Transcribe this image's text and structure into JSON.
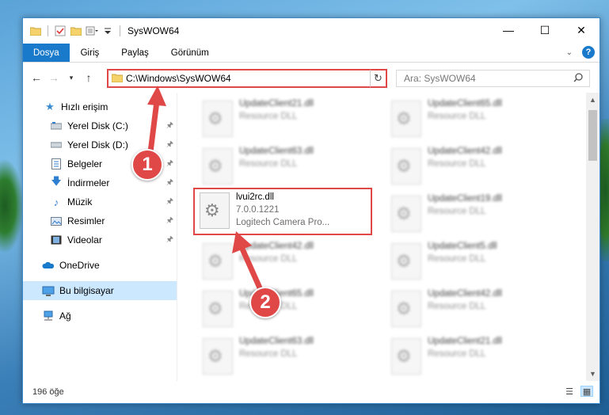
{
  "window": {
    "title": "SysWOW64",
    "controls": {
      "minimize": "—",
      "maximize": "☐",
      "close": "✕"
    }
  },
  "ribbon": {
    "tabs": [
      "Dosya",
      "Giriş",
      "Paylaş",
      "Görünüm"
    ]
  },
  "address": {
    "path": "C:\\Windows\\SysWOW64",
    "search_placeholder": "Ara: SysWOW64"
  },
  "nav": {
    "quick_access": "Hızlı erişim",
    "items": [
      {
        "label": "Yerel Disk (C:)",
        "icon": "drive-icon",
        "pinned": true
      },
      {
        "label": "Yerel Disk (D:)",
        "icon": "drive-icon",
        "pinned": true
      },
      {
        "label": "Belgeler",
        "icon": "documents-icon",
        "pinned": true
      },
      {
        "label": "İndirmeler",
        "icon": "downloads-icon",
        "pinned": true
      },
      {
        "label": "Müzik",
        "icon": "music-icon",
        "pinned": true
      },
      {
        "label": "Resimler",
        "icon": "pictures-icon",
        "pinned": true
      },
      {
        "label": "Videolar",
        "icon": "videos-icon",
        "pinned": true
      }
    ],
    "onedrive": "OneDrive",
    "this_pc": "Bu bilgisayar",
    "network": "Ağ"
  },
  "files": [
    {
      "name": "UpdateClient21.dll",
      "sub": "Resource DLL"
    },
    {
      "name": "UpdateClient65.dll",
      "sub": "Resource DLL"
    },
    {
      "name": "UpdateClient63.dll",
      "sub": "Resource DLL"
    },
    {
      "name": "UpdateClient42.dll",
      "sub": "Resource DLL"
    },
    {
      "name": "lvui2rc.dll",
      "version": "7.0.0.1221",
      "sub": "Logitech Camera Pro..."
    },
    {
      "name": "UpdateClient19.dll",
      "sub": "Resource DLL"
    },
    {
      "name": "UpdateClient42.dll",
      "sub": "Resource DLL"
    },
    {
      "name": "UpdateClient5.dll",
      "sub": "Resource DLL"
    },
    {
      "name": "UpdateClient65.dll",
      "sub": "Resource DLL"
    },
    {
      "name": "UpdateClient42.dll",
      "sub": "Resource DLL"
    },
    {
      "name": "UpdateClient63.dll",
      "sub": "Resource DLL"
    },
    {
      "name": "UpdateClient21.dll",
      "sub": "Resource DLL"
    }
  ],
  "status": {
    "count": "196 öğe"
  },
  "annotations": {
    "step1": "1",
    "step2": "2",
    "color": "#e04848"
  }
}
